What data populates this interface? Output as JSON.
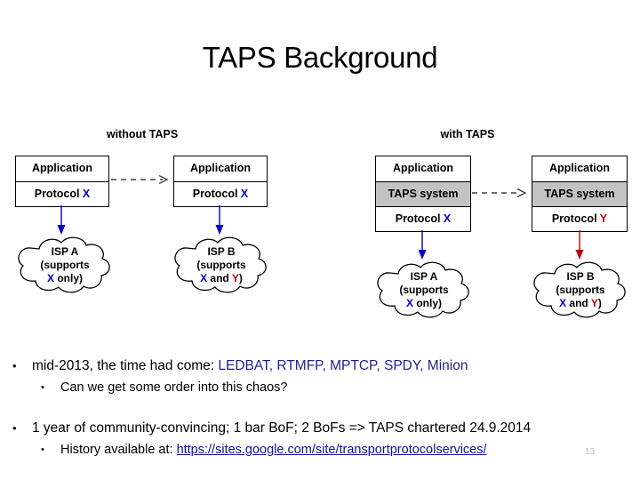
{
  "slide": {
    "title": "TAPS Background",
    "number": "13"
  },
  "diagram": {
    "groups": [
      {
        "label": "without TAPS"
      },
      {
        "label": "with TAPS"
      }
    ],
    "stacks": [
      {
        "id": "stack-1",
        "layers": [
          {
            "text": "Application",
            "style": "plain"
          },
          {
            "text": "Protocol ",
            "accent": "X",
            "accent_color": "#0000c8",
            "style": "plain"
          }
        ]
      },
      {
        "id": "stack-2",
        "layers": [
          {
            "text": "Application",
            "style": "plain"
          },
          {
            "text": "Protocol ",
            "accent": "X",
            "accent_color": "#0000c8",
            "style": "plain"
          }
        ]
      },
      {
        "id": "stack-3",
        "layers": [
          {
            "text": "Application",
            "style": "plain"
          },
          {
            "text": "TAPS system",
            "style": "gray"
          },
          {
            "text": "Protocol ",
            "accent": "X",
            "accent_color": "#0000c8",
            "style": "plain"
          }
        ]
      },
      {
        "id": "stack-4",
        "layers": [
          {
            "text": "Application",
            "style": "plain"
          },
          {
            "text": "TAPS system",
            "style": "gray"
          },
          {
            "text": "Protocol ",
            "accent": "Y",
            "accent_color": "#c00000",
            "style": "plain"
          }
        ]
      }
    ],
    "clouds": [
      {
        "id": "cloud-1",
        "line1": "ISP A",
        "line2": "(supports",
        "line3_pre": "",
        "line3_x": "X",
        "line3_mid": " only)",
        "line3_y": ""
      },
      {
        "id": "cloud-2",
        "line1": "ISP B",
        "line2": "(supports",
        "line3_pre": "",
        "line3_x": "X",
        "line3_mid": " and ",
        "line3_y": "Y",
        "line3_post": ")"
      },
      {
        "id": "cloud-3",
        "line1": "ISP A",
        "line2": "(supports",
        "line3_pre": "",
        "line3_x": "X",
        "line3_mid": " only)",
        "line3_y": ""
      },
      {
        "id": "cloud-4",
        "line1": "ISP B",
        "line2": "(supports",
        "line3_pre": "",
        "line3_x": "X",
        "line3_mid": " and ",
        "line3_y": "Y",
        "line3_post": ")"
      }
    ],
    "arrow_colors": {
      "protocol_x": "#0000c8",
      "protocol_y": "#c00000",
      "dashed": "#404040"
    }
  },
  "body": {
    "bullet1_prefix": "mid-2013, the time had come: ",
    "bullet1_accent": "LEDBAT, RTMFP, MPTCP, SPDY, Minion",
    "bullet1_sub": "Can we get some order into this chaos?",
    "bullet2": "1 year of community-convincing; 1 bar BoF; 2 BoFs => TAPS chartered 24.9.2014",
    "bullet2_sub_prefix": "History available at: ",
    "bullet2_sub_link": "https://sites.google.com/site/transportprotocolservices/"
  }
}
